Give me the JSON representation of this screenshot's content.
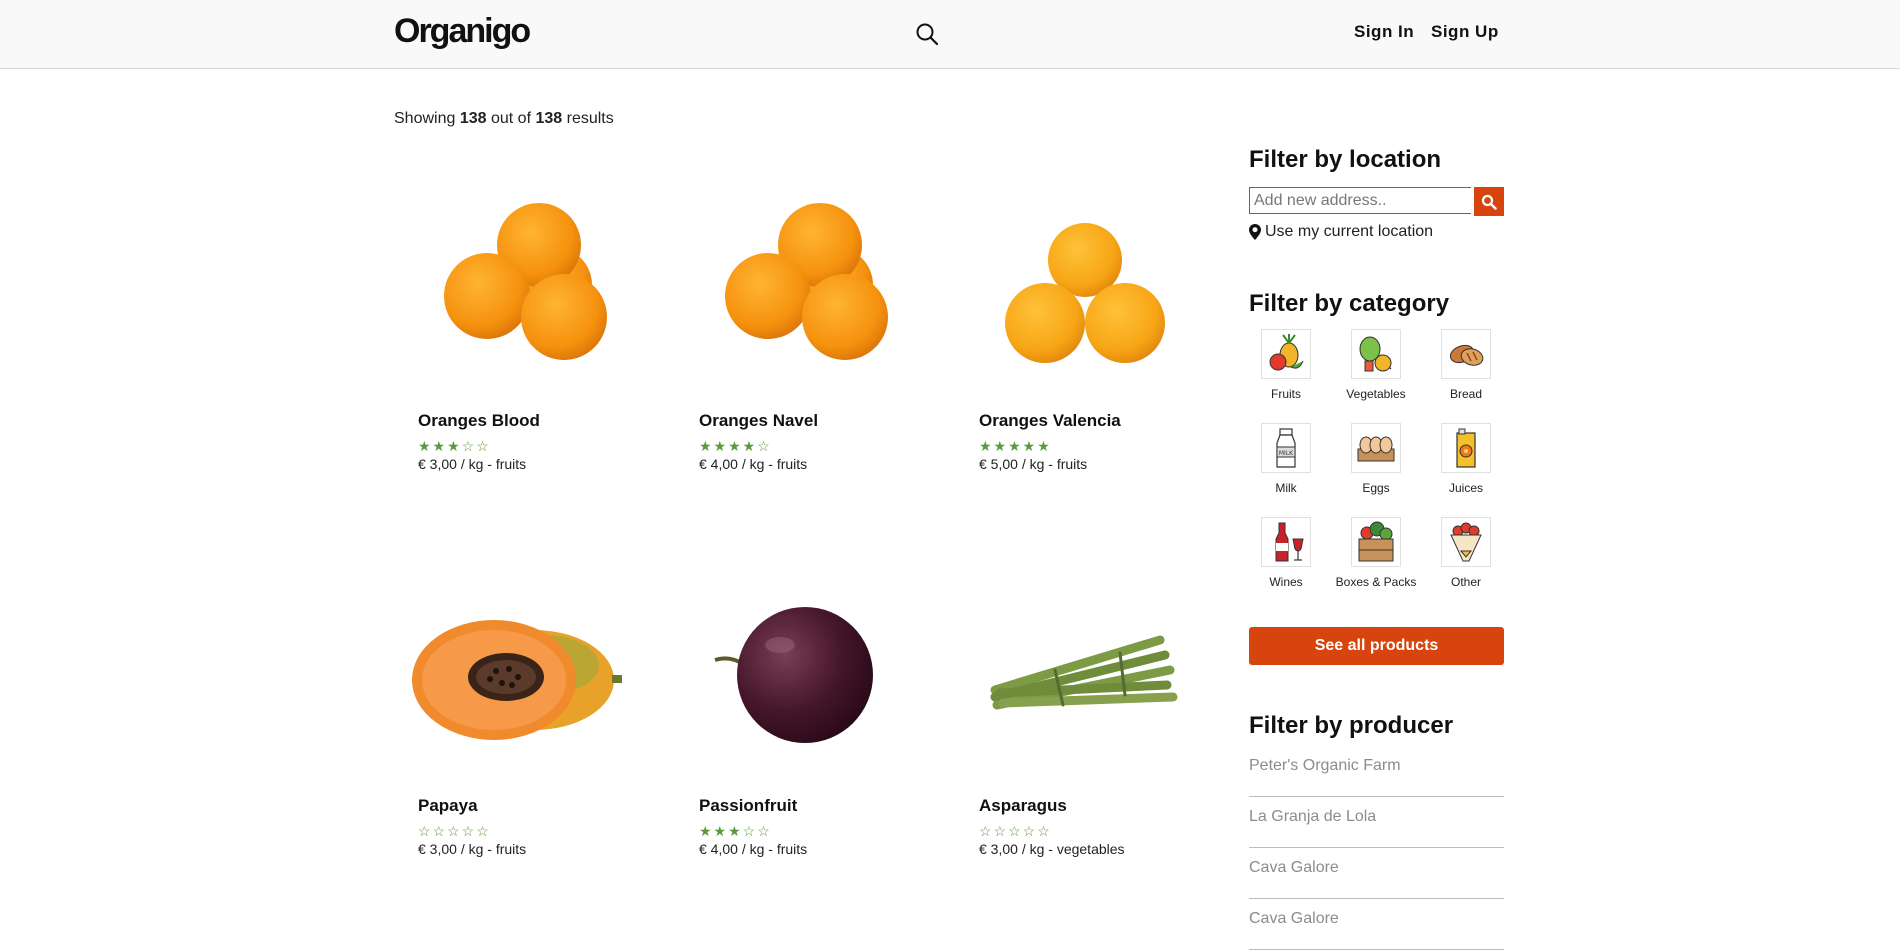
{
  "header": {
    "logo": "Organigo",
    "sign_in": "Sign In",
    "sign_up": "Sign Up"
  },
  "results": {
    "prefix": "Showing",
    "shown": "138",
    "middle": "out of",
    "total": "138",
    "suffix": "results"
  },
  "products": [
    {
      "name": "Oranges Blood",
      "stars": "★★★☆☆",
      "rating": 3,
      "price": "€ 3,00 / kg - fruits",
      "image": "oranges-blood"
    },
    {
      "name": "Oranges Navel",
      "stars": "★★★★☆",
      "rating": 4,
      "price": "€ 4,00 / kg - fruits",
      "image": "oranges-navel"
    },
    {
      "name": "Oranges Valencia",
      "stars": "★★★★★",
      "rating": 5,
      "price": "€ 5,00 / kg - fruits",
      "image": "oranges-valencia"
    },
    {
      "name": "Papaya",
      "stars": "☆☆☆☆☆",
      "rating": 0,
      "price": "€ 3,00 / kg - fruits",
      "image": "papaya"
    },
    {
      "name": "Passionfruit",
      "stars": "★★★☆☆",
      "rating": 3,
      "price": "€ 4,00 / kg - fruits",
      "image": "passionfruit"
    },
    {
      "name": "Asparagus",
      "stars": "☆☆☆☆☆",
      "rating": 0,
      "price": "€ 3,00 / kg - vegetables",
      "image": "asparagus"
    }
  ],
  "sidebar": {
    "location_title": "Filter by location",
    "address_placeholder": "Add new address..",
    "current_location": "Use my current location",
    "category_title": "Filter by category",
    "categories": [
      {
        "label": "Fruits",
        "icon": "fruits-icon"
      },
      {
        "label": "Vegetables",
        "icon": "vegetables-icon"
      },
      {
        "label": "Bread",
        "icon": "bread-icon"
      },
      {
        "label": "Milk",
        "icon": "milk-icon"
      },
      {
        "label": "Eggs",
        "icon": "eggs-icon"
      },
      {
        "label": "Juices",
        "icon": "juices-icon"
      },
      {
        "label": "Wines",
        "icon": "wines-icon"
      },
      {
        "label": "Boxes & Packs",
        "icon": "boxes-icon"
      },
      {
        "label": "Other",
        "icon": "other-icon"
      }
    ],
    "see_all": "See all products",
    "producer_title": "Filter by producer",
    "producers": [
      "Peter's Organic Farm",
      "La Granja de Lola",
      "Cava Galore",
      "Cava Galore"
    ]
  },
  "colors": {
    "accent": "#d8440e",
    "star": "#5b9a3b",
    "header_bg": "#f8f9f8"
  }
}
